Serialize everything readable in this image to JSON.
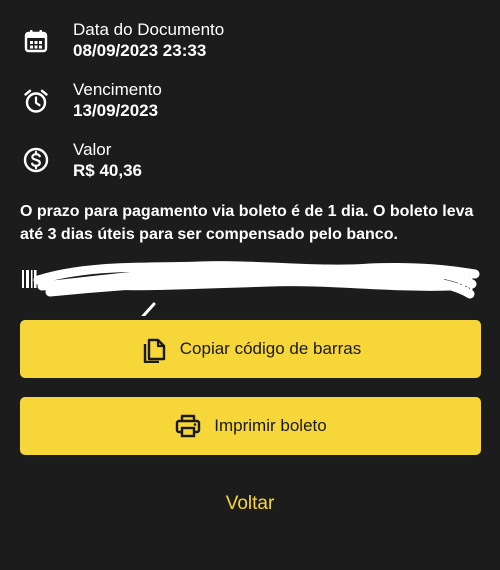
{
  "details": {
    "document_date": {
      "label": "Data do Documento",
      "value": "08/09/2023 23:33",
      "icon": "calendar-icon"
    },
    "due_date": {
      "label": "Vencimento",
      "value": "13/09/2023",
      "icon": "alarm-clock-icon"
    },
    "amount": {
      "label": "Valor",
      "value": "R$ 40,36",
      "icon": "dollar-coin-icon"
    }
  },
  "notice": "O prazo para pagamento via boleto é de 1 dia. O boleto leva até 3 dias úteis para ser compensado pelo banco.",
  "barcode": {
    "icon": "barcode-icon",
    "redacted": true
  },
  "actions": {
    "copy_label": "Copiar código de barras",
    "copy_icon": "copy-icon",
    "print_label": "Imprimir boleto",
    "print_icon": "printer-icon",
    "back_label": "Voltar"
  },
  "colors": {
    "background": "#1c1c1c",
    "accent": "#f7d639",
    "text": "#ffffff",
    "button_text": "#1a1a1a"
  }
}
